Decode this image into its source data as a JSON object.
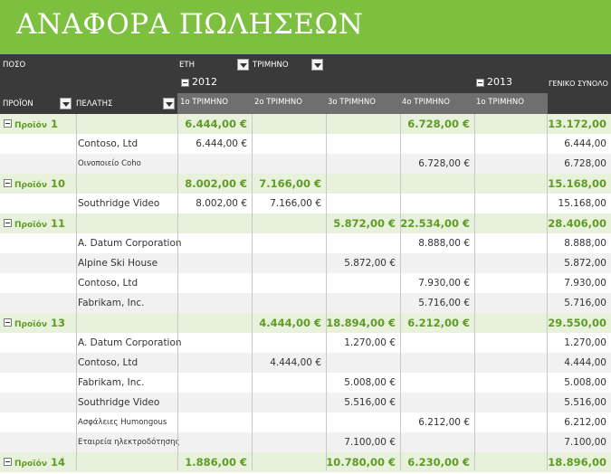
{
  "title": "ΑΝΑΦΟΡΑ ΠΩΛΗΣΕΩΝ",
  "header": {
    "values_label": "ΠΟΣΟ",
    "years_label": "ΕΤΗ",
    "quarter_label": "ΤΡΙΜΗΝΟ",
    "product_label": "ΠΡΟΪΟΝ",
    "customer_label": "ΠΕΛΑΤΗΣ",
    "year_2012": "2012",
    "year_2013": "2013",
    "grand_total_label": "ΓΕΝΙΚΟ ΣΥΝΟΛΟ",
    "quarters": [
      "1ο ΤΡΙΜΗΝΟ",
      "2ο ΤΡΙΜΗΝΟ",
      "3ο ΤΡΙΜΗΝΟ",
      "4ο ΤΡΙΜΗΝΟ",
      "1ο ΤΡΙΜΗΝΟ"
    ]
  },
  "rows": [
    {
      "type": "group",
      "name": "Προϊόν",
      "num": "1",
      "q1": "6.444,00 €",
      "q2": "",
      "q3": "",
      "q4": "6.728,00 €",
      "q5": "",
      "total": "13.172,00"
    },
    {
      "type": "detail",
      "name": "Contoso, Ltd",
      "q1": "6.444,00 €",
      "q2": "",
      "q3": "",
      "q4": "",
      "q5": "",
      "total": "6.444,00"
    },
    {
      "type": "detail",
      "name": "Οινοποιείο Coho",
      "small": true,
      "q1": "",
      "q2": "",
      "q3": "",
      "q4": "6.728,00 €",
      "q5": "",
      "total": "6.728,00"
    },
    {
      "type": "group",
      "name": "Προϊόν",
      "num": "10",
      "q1": "8.002,00 €",
      "q2": "7.166,00 €",
      "q3": "",
      "q4": "",
      "q5": "",
      "total": "15.168,00"
    },
    {
      "type": "detail",
      "name": "Southridge Video",
      "q1": "8.002,00 €",
      "q2": "7.166,00 €",
      "q3": "",
      "q4": "",
      "q5": "",
      "total": "15.168,00"
    },
    {
      "type": "group",
      "name": "Προϊόν",
      "num": "11",
      "q1": "",
      "q2": "",
      "q3": "5.872,00 €",
      "q4": "22.534,00 €",
      "q5": "",
      "total": "28.406,00"
    },
    {
      "type": "detail",
      "name": "A. Datum Corporation",
      "q1": "",
      "q2": "",
      "q3": "",
      "q4": "8.888,00 €",
      "q5": "",
      "total": "8.888,00"
    },
    {
      "type": "detail",
      "name": "Alpine Ski House",
      "q1": "",
      "q2": "",
      "q3": "5.872,00 €",
      "q4": "",
      "q5": "",
      "total": "5.872,00"
    },
    {
      "type": "detail",
      "name": "Contoso, Ltd",
      "q1": "",
      "q2": "",
      "q3": "",
      "q4": "7.930,00 €",
      "q5": "",
      "total": "7.930,00"
    },
    {
      "type": "detail",
      "name": "Fabrikam, Inc.",
      "q1": "",
      "q2": "",
      "q3": "",
      "q4": "5.716,00 €",
      "q5": "",
      "total": "5.716,00"
    },
    {
      "type": "group",
      "name": "Προϊόν",
      "num": "13",
      "q1": "",
      "q2": "4.444,00 €",
      "q3": "18.894,00 €",
      "q4": "6.212,00 €",
      "q5": "",
      "total": "29.550,00"
    },
    {
      "type": "detail",
      "name": "A. Datum Corporation",
      "q1": "",
      "q2": "",
      "q3": "1.270,00 €",
      "q4": "",
      "q5": "",
      "total": "1.270,00"
    },
    {
      "type": "detail",
      "name": "Contoso, Ltd",
      "q1": "",
      "q2": "4.444,00 €",
      "q3": "",
      "q4": "",
      "q5": "",
      "total": "4.444,00"
    },
    {
      "type": "detail",
      "name": "Fabrikam, Inc.",
      "q1": "",
      "q2": "",
      "q3": "5.008,00 €",
      "q4": "",
      "q5": "",
      "total": "5.008,00"
    },
    {
      "type": "detail",
      "name": "Southridge Video",
      "q1": "",
      "q2": "",
      "q3": "5.516,00 €",
      "q4": "",
      "q5": "",
      "total": "5.516,00"
    },
    {
      "type": "detail",
      "name": "Ασφάλειες Humongous",
      "small": true,
      "q1": "",
      "q2": "",
      "q3": "",
      "q4": "6.212,00 €",
      "q5": "",
      "total": "6.212,00"
    },
    {
      "type": "detail",
      "name": "Εταιρεία ηλεκτροδότησης",
      "small": true,
      "q1": "",
      "q2": "",
      "q3": "7.100,00 €",
      "q4": "",
      "q5": "",
      "total": "7.100,00"
    },
    {
      "type": "group",
      "name": "Προϊόν",
      "num": "14",
      "q1": "1.886,00 €",
      "q2": "",
      "q3": "10.780,00 €",
      "q4": "6.230,00 €",
      "q5": "",
      "total": "18.896,00"
    }
  ],
  "colors": {
    "accent": "#7dc03f",
    "header_dark": "#3a3a3a",
    "group_row": "#e8f1db",
    "group_text": "#5f9c25"
  }
}
